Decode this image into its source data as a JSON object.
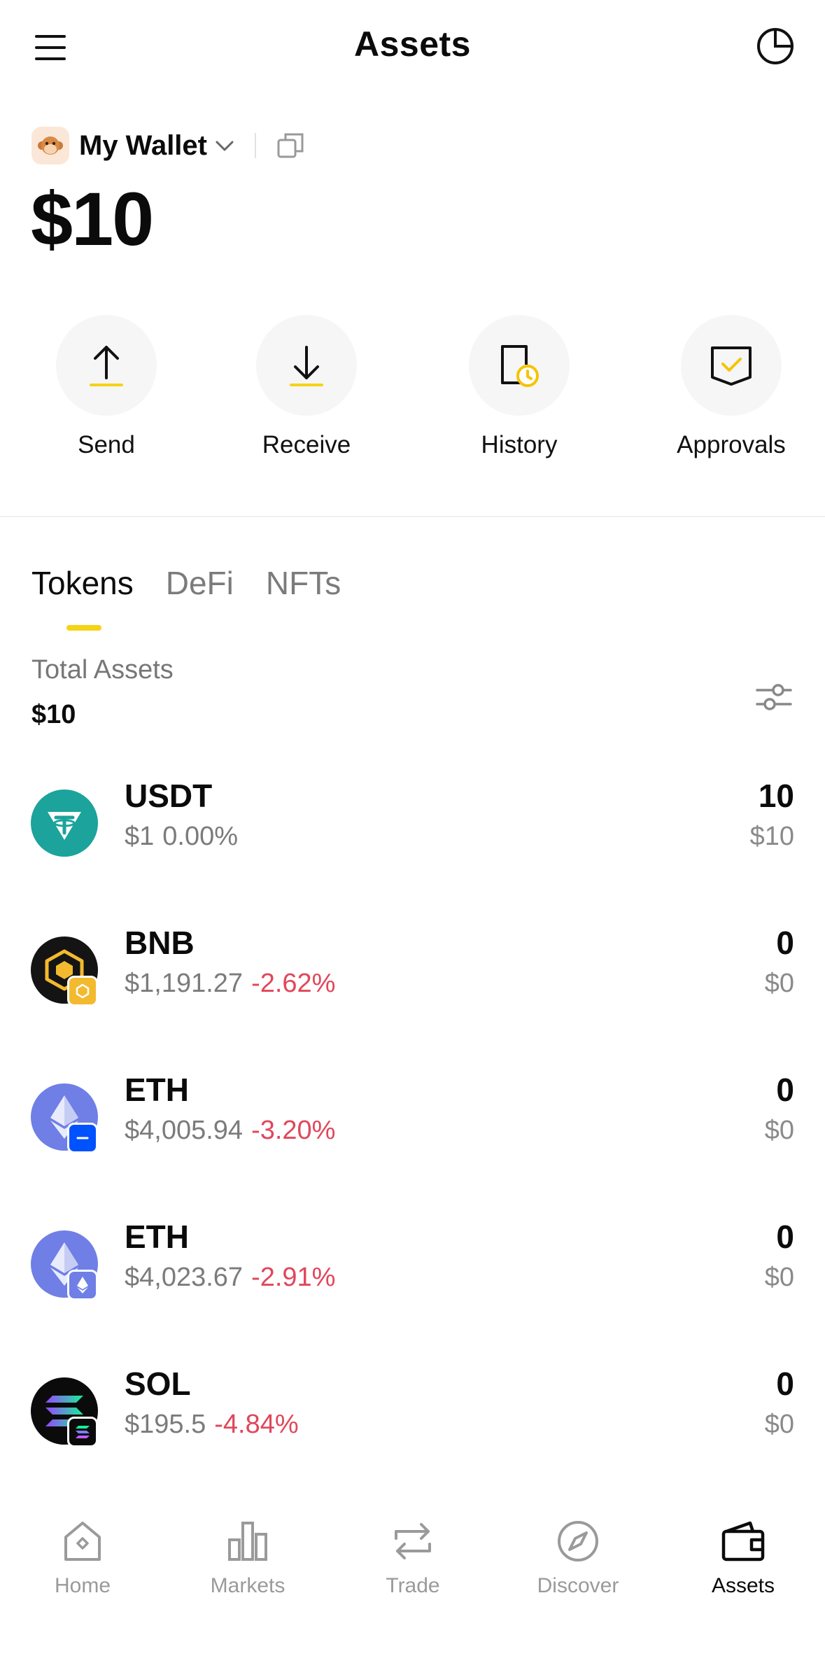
{
  "header": {
    "title": "Assets"
  },
  "wallet": {
    "name": "My Wallet",
    "balance": "$10"
  },
  "actions": [
    {
      "label": "Send",
      "icon": "arrow-up-icon"
    },
    {
      "label": "Receive",
      "icon": "arrow-down-icon"
    },
    {
      "label": "History",
      "icon": "history-icon"
    },
    {
      "label": "Approvals",
      "icon": "approvals-icon"
    }
  ],
  "tabs": [
    {
      "label": "Tokens",
      "active": true
    },
    {
      "label": "DeFi",
      "active": false
    },
    {
      "label": "NFTs",
      "active": false
    }
  ],
  "total": {
    "label": "Total Assets",
    "value": "$10"
  },
  "tokens": [
    {
      "symbol": "USDT",
      "price": "$1",
      "change": "0.00%",
      "amount": "10",
      "value": "$10"
    },
    {
      "symbol": "BNB",
      "price": "$1,191.27",
      "change": "-2.62%",
      "amount": "0",
      "value": "$0"
    },
    {
      "symbol": "ETH",
      "price": "$4,005.94",
      "change": "-3.20%",
      "amount": "0",
      "value": "$0"
    },
    {
      "symbol": "ETH",
      "price": "$4,023.67",
      "change": "-2.91%",
      "amount": "0",
      "value": "$0"
    },
    {
      "symbol": "SOL",
      "price": "$195.5",
      "change": "-4.84%",
      "amount": "0",
      "value": "$0"
    }
  ],
  "nav": [
    {
      "label": "Home",
      "active": false
    },
    {
      "label": "Markets",
      "active": false
    },
    {
      "label": "Trade",
      "active": false
    },
    {
      "label": "Discover",
      "active": false
    },
    {
      "label": "Assets",
      "active": true
    }
  ],
  "colors": {
    "accent": "#f5d316",
    "negative": "#e0475b",
    "neutral": "#7b7b7b"
  }
}
